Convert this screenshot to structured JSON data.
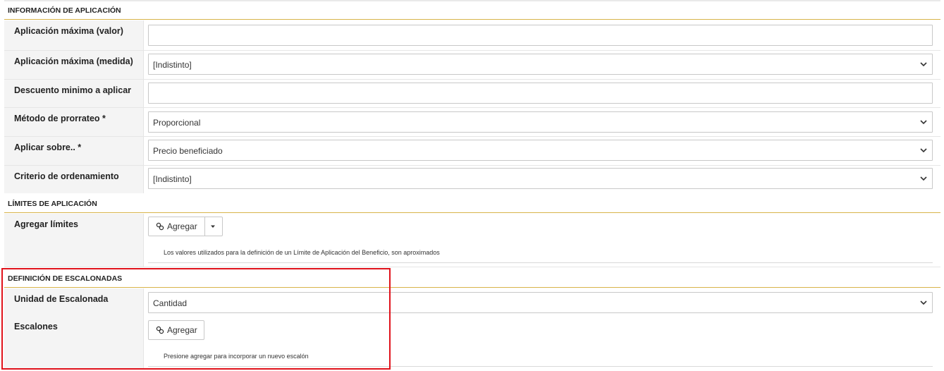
{
  "sections": {
    "info": {
      "title": "INFORMACIÓN DE APLICACIÓN",
      "rows": [
        {
          "label": "Aplicación máxima (valor)",
          "type": "input",
          "value": ""
        },
        {
          "label": "Aplicación máxima (medida)",
          "type": "select",
          "value": "[Indistinto]"
        },
        {
          "label": "Descuento minimo a aplicar",
          "type": "input",
          "value": ""
        },
        {
          "label": "Método de prorrateo *",
          "type": "select",
          "value": "Proporcional"
        },
        {
          "label": "Aplicar sobre.. *",
          "type": "select",
          "value": "Precio beneficiado"
        },
        {
          "label": "Criterio de ordenamiento",
          "type": "select",
          "value": "[Indistinto]"
        }
      ]
    },
    "limits": {
      "title": "LÍMITES DE APLICACIÓN",
      "label": "Agregar límites",
      "button_label": "Agregar",
      "help_text": "Los valores utilizados para la definición de un Límite de Aplicación del Beneficio, son aproximados"
    },
    "tiers": {
      "title": "DEFINICIÓN DE ESCALONADAS",
      "unit_label": "Unidad de Escalonada",
      "unit_value": "Cantidad",
      "steps_label": "Escalones",
      "button_label": "Agregar",
      "help_text": "Presione agregar para incorporar un nuevo escalón"
    }
  },
  "colors": {
    "section_underline": "#d8b44a",
    "highlight_border": "#e0121b",
    "label_background": "#f4f4f4"
  },
  "icons": {
    "link": "link-icon",
    "dropdown": "chevron-down-icon",
    "caret": "caret-down-icon"
  }
}
